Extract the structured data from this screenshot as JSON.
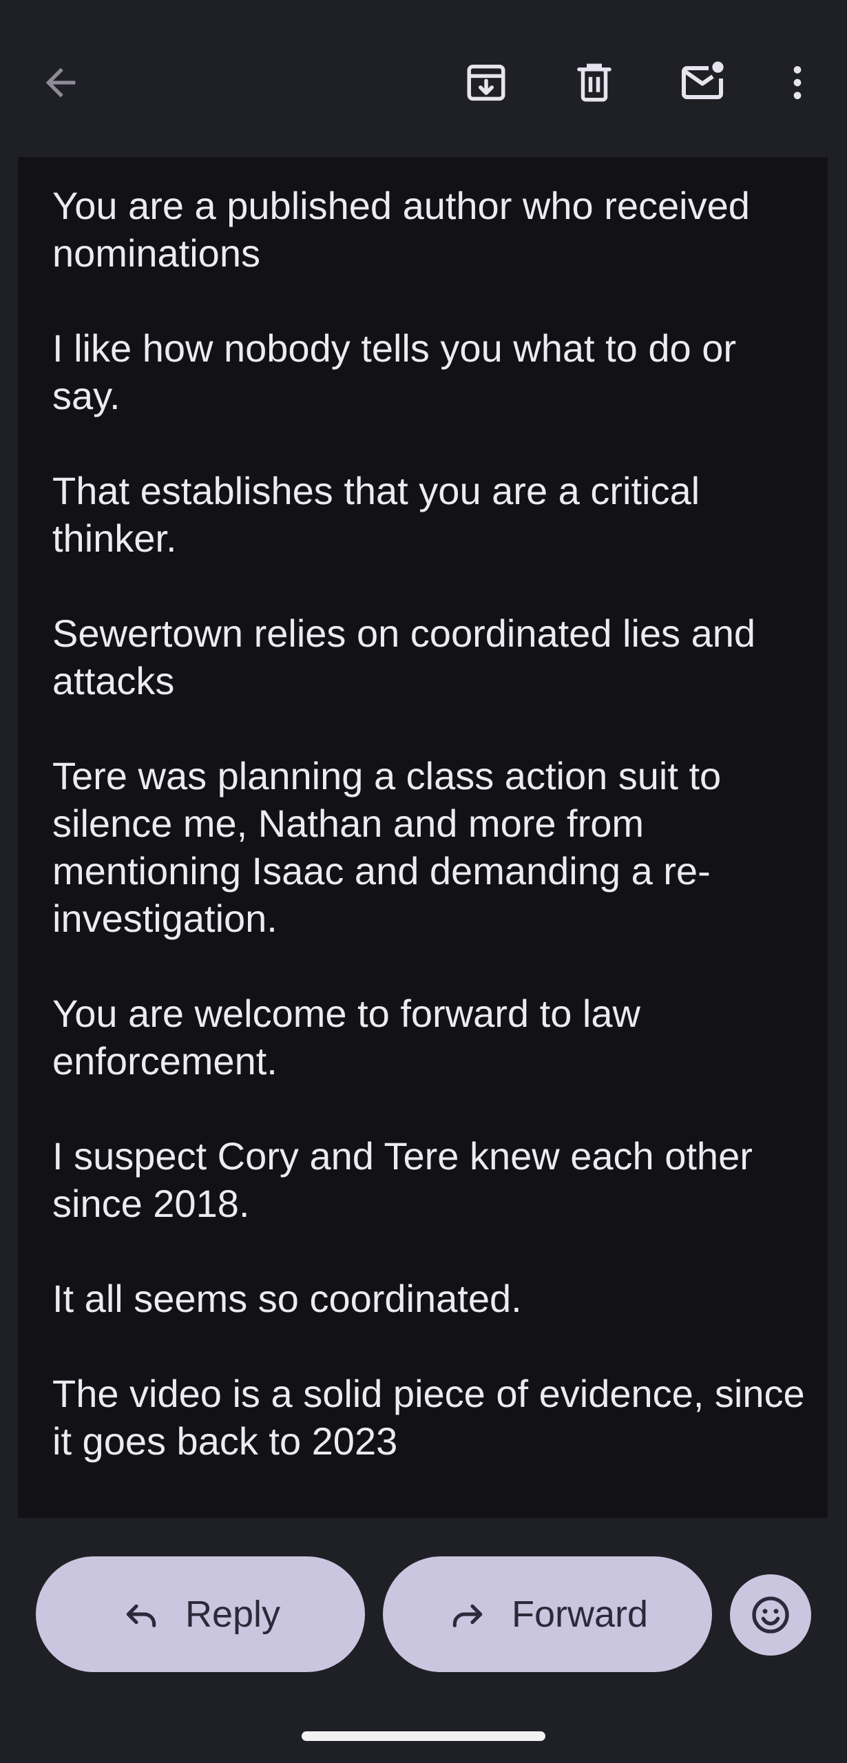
{
  "toolbar": {
    "back_icon": "arrow-back-icon",
    "archive_icon": "archive-icon",
    "delete_icon": "trash-icon",
    "mark_unread_icon": "mark-unread-icon",
    "more_icon": "more-vert-icon"
  },
  "message": {
    "paragraphs": [
      "You are a published author who received nominations",
      "I like how nobody tells you what to do or say.",
      "That establishes that you are a critical thinker.",
      "Sewertown relies on coordinated lies and attacks",
      "Tere was planning a class action suit to silence me, Nathan and more from mentioning Isaac and demanding a re-investigation.",
      "You are welcome to forward to law enforcement.",
      "I suspect Cory and Tere knew each other since 2018.",
      "It all seems so coordinated.",
      "The video is a solid piece of evidence, since it goes back to 2023"
    ]
  },
  "actions": {
    "reply_label": "Reply",
    "forward_label": "Forward",
    "reply_icon": "reply-icon",
    "forward_icon": "forward-icon",
    "emoji_icon": "add-reaction-icon"
  },
  "colors": {
    "background": "#1f1f26",
    "body_background": "#111116",
    "text": "#ecebf2",
    "button_fill": "#cbc6e0",
    "button_text": "#2c2a3a"
  }
}
